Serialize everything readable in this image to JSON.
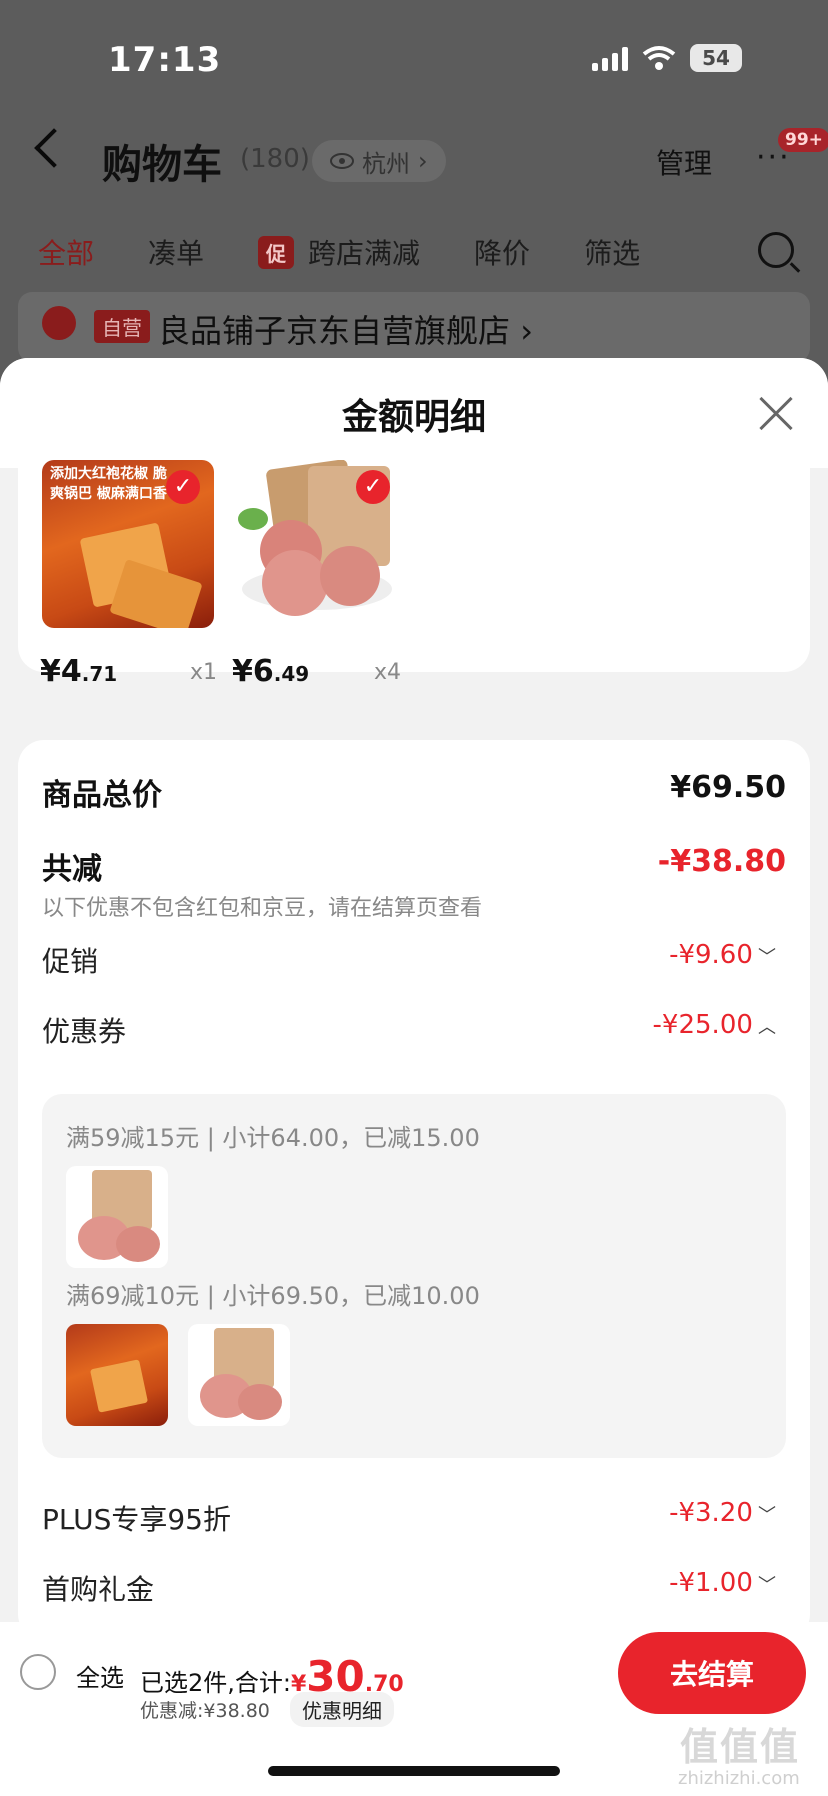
{
  "status_bar": {
    "time": "17:13",
    "battery": "54"
  },
  "nav": {
    "title": "购物车",
    "count": "(180)",
    "location": "杭州",
    "manage": "管理",
    "more": "···",
    "badge": "99+"
  },
  "tabs": [
    {
      "label": "全部"
    },
    {
      "label": "凑单"
    },
    {
      "tag": "促",
      "label": "跨店满减"
    },
    {
      "label": "降价"
    },
    {
      "label": "筛选"
    }
  ],
  "store": {
    "tag": "自营",
    "name": "良品铺子京东自营旗舰店",
    "arrow": "›"
  },
  "sheet": {
    "title": "金额明细",
    "products": [
      {
        "img_text": "添加大红袍花椒 脆爽锅巴 椒麻满口香",
        "price_int": "¥4",
        "price_dec": ".71",
        "qty": "x1"
      },
      {
        "img_text": "山楂片",
        "price_int": "¥6",
        "price_dec": ".49",
        "qty": "x4"
      }
    ],
    "summary": {
      "total_label": "商品总价",
      "total_value": "¥69.50",
      "reduce_label": "共减",
      "reduce_value": "-¥38.80",
      "note": "以下优惠不包含红包和京豆，请在结算页查看",
      "promo_label": "促销",
      "promo_value": "-¥9.60",
      "coupon_label": "优惠券",
      "coupon_value": "-¥25.00",
      "coupon_lines": [
        "满59减15元 | 小计64.00，已减15.00",
        "满69减10元 | 小计69.50，已减10.00"
      ],
      "plus_label": "PLUS专享95折",
      "plus_value": "-¥3.20",
      "first_label": "首购礼金",
      "first_value": "-¥1.00"
    }
  },
  "bottom": {
    "select_all": "全选",
    "selected": "已选2件,合计:",
    "currency": "¥",
    "total_int": "30",
    "total_dec": ".70",
    "discount": "优惠减:¥38.80",
    "detail": "优惠明细",
    "checkout": "去结算"
  },
  "watermark": {
    "text": "值值值",
    "sub": "zhizhizhi.com"
  },
  "colors": {
    "accent": "#e8242c",
    "dim_bg": "#5c5c5c"
  }
}
